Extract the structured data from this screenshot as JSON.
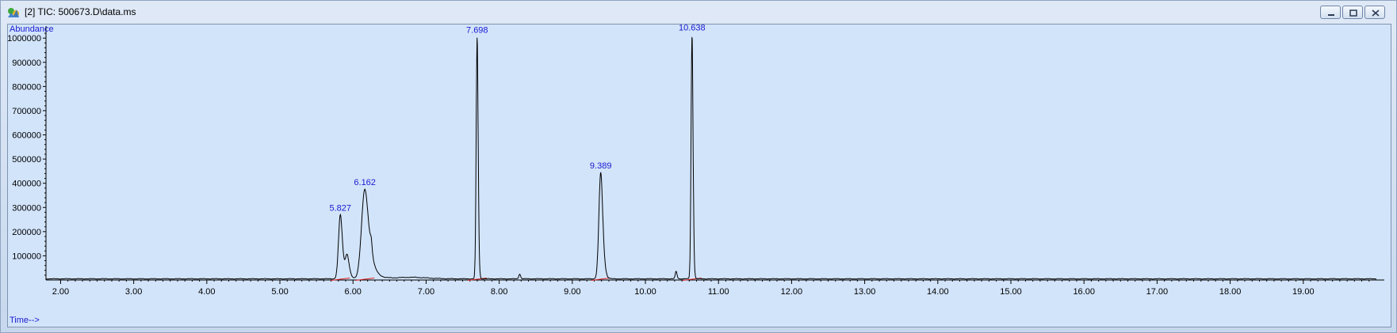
{
  "window": {
    "title": "[2] TIC: 500673.D\\data.ms",
    "icon": "chromatogram-app-icon",
    "buttons": [
      "minimize-icon",
      "restore-icon",
      "close-icon"
    ]
  },
  "colors": {
    "plot_background": "#d2e4fa",
    "trace": "#000000",
    "labels": "#1a1ad0",
    "baseline_marks": "#e02020"
  },
  "chart_data": {
    "type": "line",
    "xlabel": "Time-->",
    "ylabel": "Abundance",
    "xlim": [
      1.8,
      20.0
    ],
    "ylim": [
      0,
      1030000
    ],
    "xticks": [
      "2.00",
      "3.00",
      "4.00",
      "5.00",
      "6.00",
      "7.00",
      "8.00",
      "9.00",
      "10.00",
      "11.00",
      "12.00",
      "13.00",
      "14.00",
      "15.00",
      "16.00",
      "17.00",
      "18.00",
      "19.00"
    ],
    "yticks": [
      "100000",
      "200000",
      "300000",
      "400000",
      "500000",
      "600000",
      "700000",
      "800000",
      "900000",
      "1000000"
    ],
    "grid": false,
    "baseline": 5000,
    "peaks": [
      {
        "rt": 5.827,
        "height": 265000,
        "label": "5.827"
      },
      {
        "rt": 5.92,
        "height": 95000,
        "label": ""
      },
      {
        "rt": 6.162,
        "height": 370000,
        "label": "6.162"
      },
      {
        "rt": 6.25,
        "height": 40000,
        "label": ""
      },
      {
        "rt": 7.698,
        "height": 1000000,
        "label": "7.698"
      },
      {
        "rt": 8.28,
        "height": 20000,
        "label": ""
      },
      {
        "rt": 9.389,
        "height": 440000,
        "label": "9.389"
      },
      {
        "rt": 10.42,
        "height": 30000,
        "label": ""
      },
      {
        "rt": 10.638,
        "height": 1010000,
        "label": "10.638"
      }
    ]
  }
}
